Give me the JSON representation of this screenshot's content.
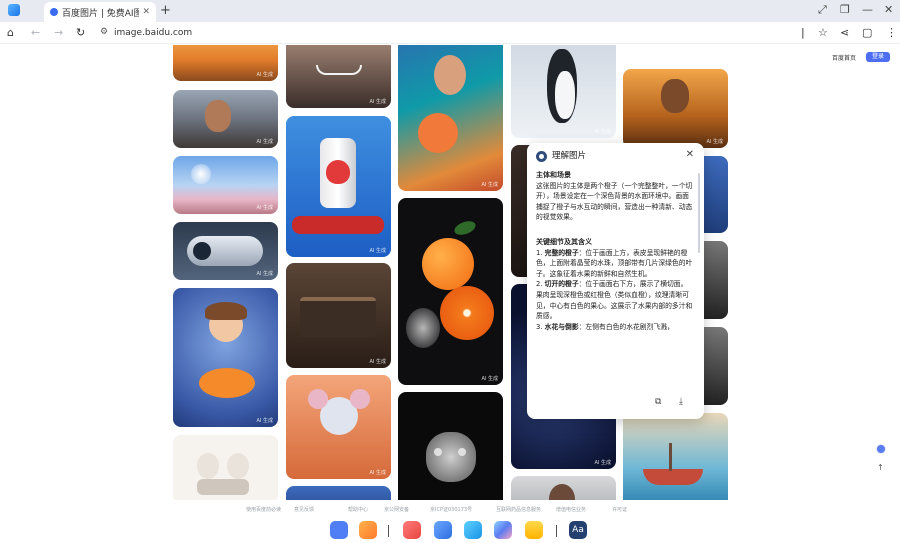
{
  "browser": {
    "tab_title": "百度图片 | 免费AI图像生",
    "tab_close": "✕",
    "new_tab": "+",
    "url": "image.baidu.com"
  },
  "page": {
    "header_link": "百度首页",
    "header_button": "登录",
    "ai_badge": "AI 生成"
  },
  "dialog": {
    "title": "理解图片",
    "close": "✕",
    "section1_title": "主体和场景",
    "section1_text": "这张图片的主体是两个橙子（一个完整整叶，一个切开），场景设定在一个深色背景的水面环境中。画面捕捉了橙子与水互动的瞬间，营造出一种清新、动态的视觉效果。",
    "section2_title": "关键细节及其含义",
    "items": [
      {
        "label": "1. ",
        "bold": "完整的橙子",
        "text": "：位于画面上方，表皮呈现鲜艳的橙色，上面附着晶莹的水珠，顶部带有几片深绿色的叶子。这象征着水果的新鲜和自然生机。"
      },
      {
        "label": "2. ",
        "bold": "切开的橙子",
        "text": "：位于画面右下方，展示了横切面。果肉呈现深橙色或红橙色（类似血橙），纹理清晰可见，中心有白色的果心。这展示了水果内部的多汁和质感。"
      },
      {
        "label": "3. ",
        "bold": "水花与倒影",
        "text": "：左侧有白色的水花剧烈飞溅，"
      }
    ],
    "copy_icon": "⧉",
    "download_icon": "⤓"
  },
  "footer": {
    "items": [
      "使用百度前必读",
      "意见反馈",
      "帮助中心",
      "京公网安备",
      "京ICP证030173号",
      "互联网药品信息服务",
      "增值电信业务",
      "许可证"
    ]
  },
  "dock": {
    "font_label": "Aa"
  }
}
